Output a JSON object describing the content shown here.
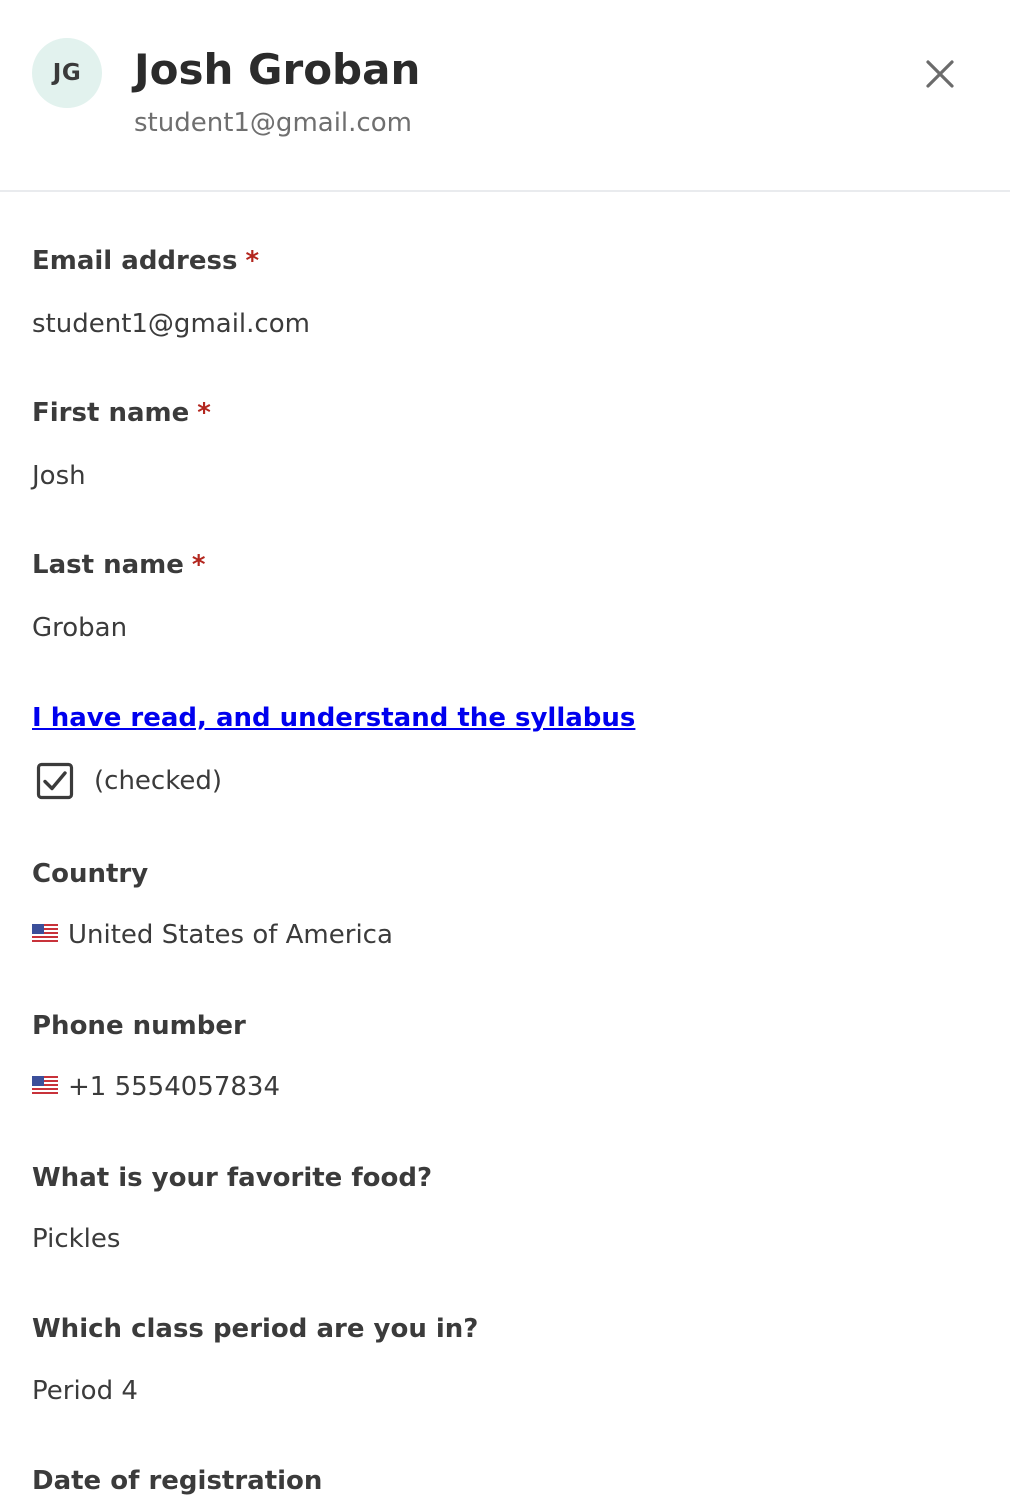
{
  "header": {
    "avatar_initials": "JG",
    "name": "Josh Groban",
    "email": "student1@gmail.com",
    "close_icon": "close-icon"
  },
  "fields": {
    "email": {
      "label": "Email address",
      "required_mark": "*",
      "value": "student1@gmail.com"
    },
    "first_name": {
      "label": "First name",
      "required_mark": "*",
      "value": "Josh"
    },
    "last_name": {
      "label": "Last name",
      "required_mark": "*",
      "value": "Groban"
    },
    "syllabus": {
      "link_text": "I have read, and understand the syllabus",
      "checkbox_icon": "checkbox-checked-icon",
      "status_text": "(checked)"
    },
    "country": {
      "label": "Country",
      "flag_icon": "us-flag-icon",
      "value": "United States of America"
    },
    "phone": {
      "label": "Phone number",
      "flag_icon": "us-flag-icon",
      "value": "+1 5554057834"
    },
    "favorite_food": {
      "label": "What is your favorite food?",
      "value": "Pickles"
    },
    "class_period": {
      "label": "Which class period are you in?",
      "value": "Period 4"
    },
    "registration_date": {
      "label": "Date of registration"
    }
  },
  "colors": {
    "avatar_bg": "#e2f2ee",
    "required": "#b3261e",
    "link": "#0000ee",
    "divider": "#e9ebee"
  }
}
